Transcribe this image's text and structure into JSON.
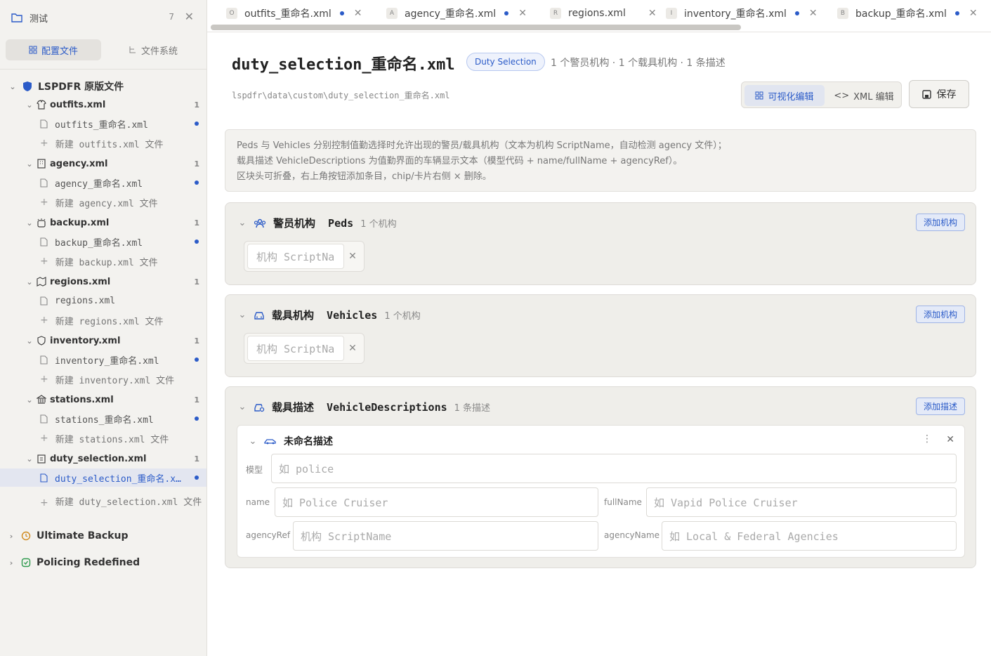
{
  "sidebar": {
    "title": "测试",
    "count": "7",
    "tabs": [
      {
        "label": "配置文件",
        "active": true
      },
      {
        "label": "文件系统",
        "active": false
      }
    ],
    "root": "LSPDFR 原版文件",
    "groups": [
      {
        "name": "outfits.xml",
        "count": "1",
        "icon": "shirt-icon",
        "files": [
          "outfits_重命名.xml"
        ],
        "new": "新建 outfits.xml 文件"
      },
      {
        "name": "agency.xml",
        "count": "1",
        "icon": "building-icon",
        "files": [
          "agency_重命名.xml"
        ],
        "new": "新建 agency.xml 文件"
      },
      {
        "name": "backup.xml",
        "count": "1",
        "icon": "siren-icon",
        "files": [
          "backup_重命名.xml"
        ],
        "new": "新建 backup.xml 文件"
      },
      {
        "name": "regions.xml",
        "count": "1",
        "icon": "map-icon",
        "files": [
          "regions.xml"
        ],
        "new": "新建 regions.xml 文件"
      },
      {
        "name": "inventory.xml",
        "count": "1",
        "icon": "shield-icon",
        "files": [
          "inventory_重命名.xml"
        ],
        "new": "新建 inventory.xml 文件"
      },
      {
        "name": "stations.xml",
        "count": "1",
        "icon": "landmark-icon",
        "files": [
          "stations_重命名.xml"
        ],
        "new": "新建 stations.xml 文件"
      },
      {
        "name": "duty_selection.xml",
        "count": "1",
        "icon": "clipboard-icon",
        "files": [
          "duty_selection_重命名.x…"
        ],
        "new": "新建 duty_selection.xml 文件"
      }
    ],
    "others": [
      "Ultimate Backup",
      "Policing Redefined"
    ]
  },
  "tabs": [
    {
      "letter": "O",
      "label": "outfits_重命名.xml",
      "dirty": true
    },
    {
      "letter": "A",
      "label": "agency_重命名.xml",
      "dirty": true
    },
    {
      "letter": "R",
      "label": "regions.xml",
      "dirty": false
    },
    {
      "letter": "I",
      "label": "inventory_重命名.xml",
      "dirty": true
    },
    {
      "letter": "B",
      "label": "backup_重命名.xml",
      "dirty": true
    }
  ],
  "header": {
    "title": "duty_selection_重命名.xml",
    "pill": "Duty Selection",
    "stats": "1 个警员机构 · 1 个载具机构 · 1 条描述",
    "path": "lspdfr\\data\\custom\\duty_selection_重命名.xml",
    "visual": "可视化编辑",
    "xml": "XML 编辑",
    "save": "保存"
  },
  "info": [
    "Peds 与 Vehicles 分别控制值勤选择时允许出现的警员/载具机构（文本为机构 ScriptName，自动检测 agency 文件）；",
    "载具描述 VehicleDescriptions 为值勤界面的车辆显示文本（模型代码 + name/fullName + agencyRef）。",
    "区块头可折叠，右上角按钮添加条目，chip/卡片右侧 × 删除。"
  ],
  "peds": {
    "title": "警员机构  Peds",
    "sub": "1 个机构",
    "add": "添加机构",
    "placeholder": "机构 ScriptNa"
  },
  "vehicles": {
    "title": "载具机构  Vehicles",
    "sub": "1 个机构",
    "add": "添加机构",
    "placeholder": "机构 ScriptNa"
  },
  "descs": {
    "title": "载具描述  VehicleDescriptions",
    "sub": "1 条描述",
    "add": "添加描述",
    "item": {
      "title": "未命名描述",
      "model_label": "模型",
      "model_ph": "如 police",
      "name_label": "name",
      "name_ph": "如 Police Cruiser",
      "full_label": "fullName",
      "full_ph": "如 Vapid Police Cruiser",
      "ref_label": "agencyRef",
      "ref_ph": "机构 ScriptName",
      "an_label": "agencyName",
      "an_ph": "如 Local & Federal Agencies"
    }
  }
}
